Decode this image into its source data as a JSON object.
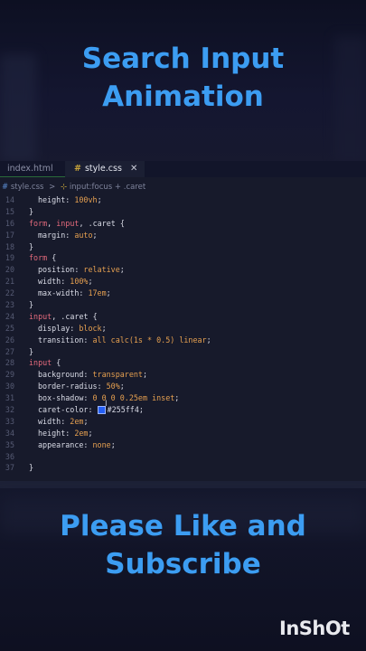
{
  "headline_top": [
    "Search Input",
    "Animation"
  ],
  "headline_bottom": [
    "Please Like and",
    "Subscribe"
  ],
  "tabs": {
    "inactive": "index.html",
    "active_hash": "#",
    "active": "style.css",
    "close": "✕"
  },
  "breadcrumb": {
    "hash": "#",
    "file": "style.css",
    "sep": ">",
    "selector": "input:focus + .caret"
  },
  "code_lines": [
    {
      "n": "14",
      "parts": [
        [
          "prop",
          "height: "
        ],
        [
          "num",
          "100vh"
        ],
        [
          "prop",
          ";"
        ]
      ],
      "indent": 1
    },
    {
      "n": "15",
      "parts": [
        [
          "prop",
          "}"
        ]
      ],
      "indent": 0
    },
    {
      "n": "16",
      "parts": [
        [
          "sel",
          "form"
        ],
        [
          "prop",
          ", "
        ],
        [
          "sel",
          "input"
        ],
        [
          "prop",
          ", .caret {"
        ]
      ],
      "indent": 0
    },
    {
      "n": "17",
      "parts": [
        [
          "prop",
          "margin: "
        ],
        [
          "val",
          "auto"
        ],
        [
          "prop",
          ";"
        ]
      ],
      "indent": 1
    },
    {
      "n": "18",
      "parts": [
        [
          "prop",
          "}"
        ]
      ],
      "indent": 0
    },
    {
      "n": "19",
      "parts": [
        [
          "sel",
          "form"
        ],
        [
          "prop",
          " {"
        ]
      ],
      "indent": 0
    },
    {
      "n": "20",
      "parts": [
        [
          "prop",
          "position: "
        ],
        [
          "val",
          "relative"
        ],
        [
          "prop",
          ";"
        ]
      ],
      "indent": 1
    },
    {
      "n": "21",
      "parts": [
        [
          "prop",
          "width: "
        ],
        [
          "num",
          "100%"
        ],
        [
          "prop",
          ";"
        ]
      ],
      "indent": 1
    },
    {
      "n": "22",
      "parts": [
        [
          "prop",
          "max-width: "
        ],
        [
          "num",
          "17em"
        ],
        [
          "prop",
          ";"
        ]
      ],
      "indent": 1
    },
    {
      "n": "23",
      "parts": [
        [
          "prop",
          "}"
        ]
      ],
      "indent": 0
    },
    {
      "n": "24",
      "parts": [
        [
          "sel",
          "input"
        ],
        [
          "prop",
          ", .caret {"
        ]
      ],
      "indent": 0
    },
    {
      "n": "25",
      "parts": [
        [
          "prop",
          "display: "
        ],
        [
          "val",
          "block"
        ],
        [
          "prop",
          ";"
        ]
      ],
      "indent": 1
    },
    {
      "n": "26",
      "parts": [
        [
          "prop",
          "transition: "
        ],
        [
          "val",
          "all calc(1s * 0.5) linear"
        ],
        [
          "prop",
          ";"
        ]
      ],
      "indent": 1
    },
    {
      "n": "27",
      "parts": [
        [
          "prop",
          "}"
        ]
      ],
      "indent": 0
    },
    {
      "n": "28",
      "parts": [
        [
          "sel",
          "input"
        ],
        [
          "prop",
          " {"
        ]
      ],
      "indent": 0
    },
    {
      "n": "29",
      "parts": [
        [
          "prop",
          "background: "
        ],
        [
          "val",
          "transparent"
        ],
        [
          "prop",
          ";"
        ]
      ],
      "indent": 1
    },
    {
      "n": "30",
      "parts": [
        [
          "prop",
          "border-radius: "
        ],
        [
          "num",
          "50%"
        ],
        [
          "prop",
          ";"
        ]
      ],
      "indent": 1
    },
    {
      "n": "31",
      "parts": [
        [
          "prop",
          "box-shadow: "
        ],
        [
          "num",
          "0 0 0 0.25em"
        ],
        [
          "val",
          " inset"
        ],
        [
          "prop",
          ";"
        ]
      ],
      "indent": 1
    },
    {
      "n": "32",
      "parts": [
        [
          "prop",
          "caret-color: "
        ],
        [
          "swatch",
          ""
        ],
        [
          "prop",
          "#255ff4;"
        ]
      ],
      "indent": 1
    },
    {
      "n": "33",
      "parts": [
        [
          "prop",
          "width: "
        ],
        [
          "num",
          "2em"
        ],
        [
          "prop",
          ";"
        ]
      ],
      "indent": 1
    },
    {
      "n": "34",
      "parts": [
        [
          "prop",
          "height: "
        ],
        [
          "num",
          "2em"
        ],
        [
          "prop",
          ";"
        ]
      ],
      "indent": 1
    },
    {
      "n": "35",
      "parts": [
        [
          "prop",
          "appearance: "
        ],
        [
          "val",
          "none"
        ],
        [
          "prop",
          ";"
        ]
      ],
      "indent": 1
    },
    {
      "n": "36",
      "parts": [],
      "indent": 0
    },
    {
      "n": "37",
      "parts": [
        [
          "prop",
          "}"
        ]
      ],
      "indent": 0
    }
  ],
  "colors": {
    "headline": "#3c9df2",
    "selector": "#e46a7c",
    "value": "#e6a050",
    "swatch": "#255ff4"
  },
  "watermark": "InShOt"
}
